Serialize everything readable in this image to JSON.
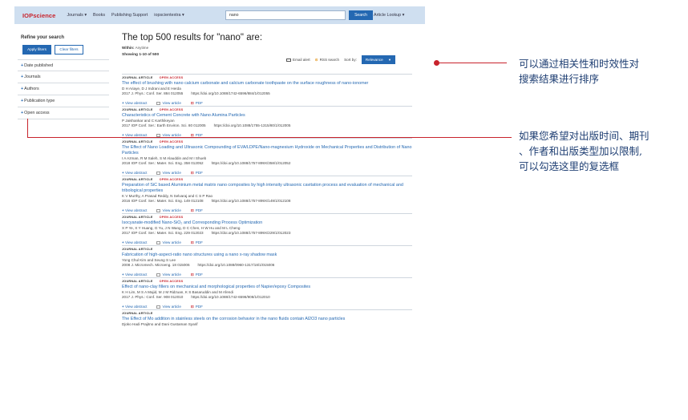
{
  "header": {
    "logo": "IOPscience",
    "nav": [
      "Journals ▾",
      "Books",
      "Publishing Support",
      "iopscientextra ▾"
    ],
    "search_value": "nano",
    "search_button": "Search",
    "article_lookup": "Article Lookup ▾"
  },
  "sidebar": {
    "title": "Refine your search",
    "apply_label": "Apply filters",
    "clear_label": "Clear filters",
    "filters": [
      "Date published",
      "Journals",
      "Authors",
      "Publication type",
      "Open access"
    ]
  },
  "main": {
    "headline": "The top 500 results for \"nano\" are:",
    "within_label": "Within:",
    "within_value": "Anytime",
    "showing": "Showing 1-10 of 500",
    "email_alert": "Email alert",
    "rss": "RSS search",
    "sort_label": "Sort by:",
    "sort_value": "Relevance"
  },
  "results": [
    {
      "type": "JOURNAL ARTICLE",
      "oa": "OPEN ACCESS",
      "title": "The effect of brushing with nano calcium carbonate and calcium carbonate toothpaste on the surface roughness of nano-ionomer",
      "authors": "D H Ariaye, D J Indrani and E Herda",
      "citation": "2017 J. Phys.: Conf. Ser. 884 012055",
      "doi": "https://doi.org/10.1088/1742-6596/884/1/012055"
    },
    {
      "type": "JOURNAL ARTICLE",
      "oa": "OPEN ACCESS",
      "title": "Characteristics of Cement Concrete with Nano Alumina Particles",
      "authors": "P Jaishankar and C Karthikeyan",
      "citation": "2017 IOP Conf. Ser.: Earth Environ. Sci. 80 012005",
      "doi": "https://doi.org/10.1088/1755-1315/80/1/012005"
    },
    {
      "type": "JOURNAL ARTICLE",
      "oa": "OPEN ACCESS",
      "title": "The Effect of Nano Loading and Ultrasonic Compounding of EVA/LDPE/Nano-magnesium Hydroxide on Mechanical Properties and Distribution of Nano Particles",
      "authors": "I A Azman, R M Saleh, S M Alauddin and M I Shueb",
      "citation": "2018 IOP Conf. Ser.: Mater. Sci. Eng. 358 012052",
      "doi": "https://doi.org/10.1088/1757-899X/358/1/012052"
    },
    {
      "type": "JOURNAL ARTICLE",
      "oa": "OPEN ACCESS",
      "title": "Preparation of SiC based Aluminium metal matrix nano composites by high intensity ultrasonic cavitation process and evaluation of mechanical and tribological properties",
      "authors": "K V Murthy, A Prasad Reddy, N Selvaraj and C S P Rao",
      "citation": "2016 IOP Conf. Ser.: Mater. Sci. Eng. 149 012108",
      "doi": "https://doi.org/10.1088/1757-899X/149/1/012108"
    },
    {
      "type": "JOURNAL ARTICLE",
      "oa": "OPEN ACCESS",
      "title": "Isocyanate-modified Nano-SiO₂ and Corresponding Process Optimization",
      "authors": "X P Ye, X Y Huang, G Yu, J N Wang, D C Chen, H W Hu and M L Cheng",
      "citation": "2017 IOP Conf. Ser.: Mater. Sci. Eng. 229 012023",
      "doi": "https://doi.org/10.1088/1757-899X/229/1/012023"
    },
    {
      "type": "JOURNAL ARTICLE",
      "oa": "",
      "title": "Fabrication of high-aspect-ratio nano structures using a nano x-ray shadow mask",
      "authors": "Yong Chul Kim and Seung S Lee",
      "citation": "2008 J. Micromech. Microeng. 18 015006",
      "doi": "https://doi.org/10.1088/0960-1317/18/1/015006"
    },
    {
      "type": "JOURNAL ARTICLE",
      "oa": "OPEN ACCESS",
      "title": "Effect of nano-clay fillers on mechanical and morphological properties of Napier/epoxy Composites",
      "authors": "K H Lim, M S A Majid, M J M Ridzuan, K S Basaruddin and M Afendi",
      "citation": "2017 J. Phys.: Conf. Ser. 908 012010",
      "doi": "https://doi.org/10.1088/1742-6596/908/1/012010"
    },
    {
      "type": "JOURNAL ARTICLE",
      "oa": "",
      "title": "The Effect of Mo addition in stainless steels on the corrosion behavior in the nano fluids contain Al2O3 nano particles",
      "authors": "Djoko Hadi Prajitno and Dani Gustaman Syarif",
      "citation": "",
      "doi": ""
    }
  ],
  "actions": {
    "view_abstract": "View abstract",
    "view_article": "View article",
    "pdf": "PDF"
  },
  "annotations": {
    "sort_note": [
      "可以通过相关性和时效性对",
      "搜索结果进行排序"
    ],
    "filter_note": [
      "如果您希望对出版时间、期刊",
      "、作者和出版类型加以限制,",
      "可以勾选这里的复选框"
    ]
  },
  "colors": {
    "brand": "#2468b2",
    "accent": "#c8232c",
    "topbar": "#cfdff0"
  }
}
